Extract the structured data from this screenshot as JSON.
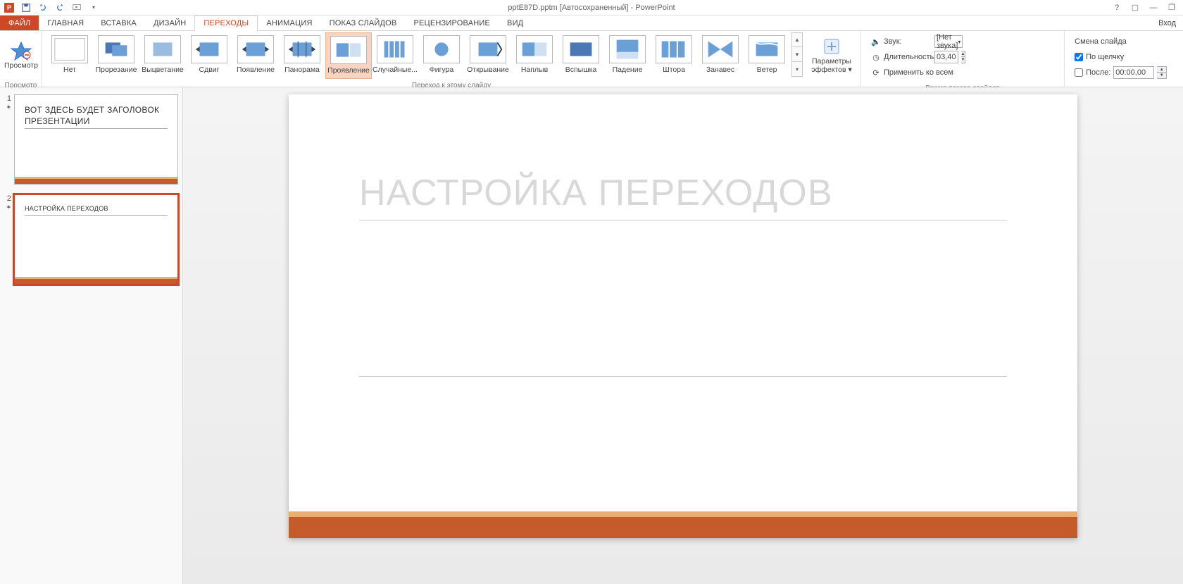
{
  "titlebar": {
    "title": "pptE87D.pptm [Автосохраненный] - PowerPoint",
    "login": "Вход"
  },
  "tabs": {
    "file": "ФАЙЛ",
    "items": [
      "ГЛАВНАЯ",
      "ВСТАВКА",
      "ДИЗАЙН",
      "ПЕРЕХОДЫ",
      "АНИМАЦИЯ",
      "ПОКАЗ СЛАЙДОВ",
      "РЕЦЕНЗИРОВАНИЕ",
      "ВИД"
    ],
    "active_index": 3
  },
  "ribbon": {
    "preview": {
      "label": "Просмотр",
      "group": "Просмотр"
    },
    "transitions": {
      "group": "Переход к этому слайду",
      "items": [
        "Нет",
        "Прорезание",
        "Выцветание",
        "Сдвиг",
        "Появление",
        "Панорама",
        "Проявление",
        "Случайные...",
        "Фигура",
        "Открывание",
        "Наплыв",
        "Вспышка",
        "Падение",
        "Штора",
        "Занавес",
        "Ветер"
      ],
      "selected_index": 6,
      "effect_options": "Параметры эффектов"
    },
    "timing": {
      "group": "Время показа слайдов",
      "sound_label": "Звук:",
      "sound_value": "[Нет звука]",
      "duration_label": "Длительность:",
      "duration_value": "03,40",
      "apply_all": "Применить ко всем",
      "advance_label": "Смена слайда",
      "on_click": "По щелчку",
      "on_click_checked": true,
      "after_label": "После:",
      "after_checked": false,
      "after_value": "00:00,00"
    }
  },
  "slides": {
    "items": [
      {
        "num": "1",
        "title": "ВОТ ЗДЕСЬ БУДЕТ ЗАГОЛОВОК ПРЕЗЕНТАЦИИ"
      },
      {
        "num": "2",
        "title": "НАСТРОЙКА ПЕРЕХОДОВ"
      }
    ],
    "active_index": 1
  },
  "canvas": {
    "title": "НАСТРОЙКА ПЕРЕХОДОВ"
  }
}
